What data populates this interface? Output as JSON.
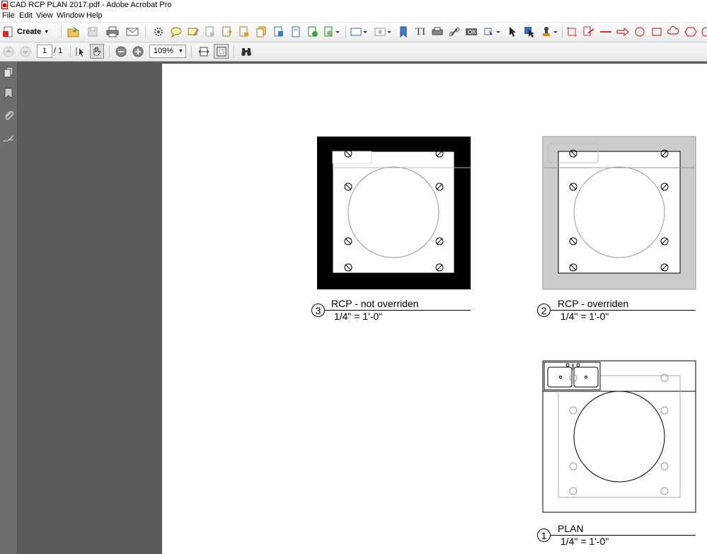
{
  "window": {
    "title": "CAD RCP PLAN 2017.pdf - Adobe Acrobat Pro"
  },
  "menu": {
    "items": [
      "File",
      "Edit",
      "View",
      "Window",
      "Help"
    ]
  },
  "toolbar": {
    "create_label": "Create",
    "page_current": "1",
    "page_total": "/ 1",
    "zoom": "109%"
  },
  "drawing": {
    "views": [
      {
        "number": "3",
        "title": "RCP - not overriden",
        "scale": "1/4\" = 1'-0\""
      },
      {
        "number": "2",
        "title": "RCP - overriden",
        "scale": "1/4\" = 1'-0\""
      },
      {
        "number": "1",
        "title": "PLAN",
        "scale": "1/4\" = 1'-0\""
      }
    ]
  },
  "colors": {
    "accent_red": "#d42a2a",
    "sidebar": "#6e6e6e",
    "canvas": "#5a5a5a",
    "override_gray": "#cccccc"
  }
}
